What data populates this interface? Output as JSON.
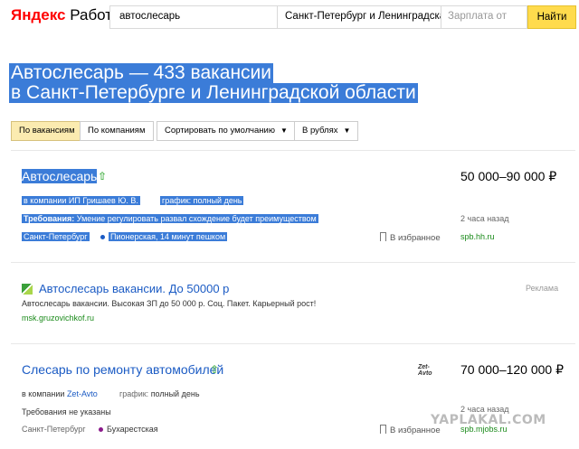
{
  "header": {
    "logo_brand": "Яндекс",
    "logo_product": "Работа",
    "query": "автослесарь",
    "region": "Санкт-Петербург и Ленинградская",
    "salary_placeholder": "Зарплата от",
    "find_label": "Найти"
  },
  "page": {
    "title_line1": "Автослесарь — 433 вакансии",
    "title_line2": "в Санкт-Петербурге и Ленинградской области"
  },
  "filters": {
    "by_vacancies": "По вакансиям",
    "by_companies": "По компаниям",
    "sort": "Сортировать по умолчанию",
    "currency": "В рублях"
  },
  "vacancies": [
    {
      "title": "Автослесарь",
      "company_prefix": "в компании ИП Гришаев Ю. В.",
      "schedule": "график: полный день",
      "requirements_label": "Требования:",
      "requirements": "Умение регулировать развал схождение будет преимуществом",
      "city": "Санкт-Петербург",
      "metro": "Пионерская, 14 минут пешком",
      "metro_color": "#1b5bc4",
      "salary": "50 000–90 000 ₽",
      "time": "2 часа назад",
      "bookmark": "В избранное",
      "source": "spb.hh.ru"
    },
    {
      "title": "Слесарь по ремонту автомобилей",
      "company_prefix": "в компании",
      "company_name": "Zet-Avto",
      "schedule_label": "график:",
      "schedule_value": "полный день",
      "requirements": "Требования не указаны",
      "city": "Санкт-Петербург",
      "metro": "Бухарестская",
      "metro_color": "#8b1a8b",
      "salary": "70 000–120 000 ₽",
      "time": "2 часа назад",
      "bookmark": "В избранное",
      "source": "spb.mjobs.ru",
      "company_logo": "Zet-Avto"
    }
  ],
  "ad": {
    "title": "Автослесарь вакансии. До 50000 р",
    "text": "Автослесарь вакансии. Высокая ЗП до 50 000 р. Соц. Пакет. Карьерный рост!",
    "url": "msk.gruzovichkof.ru",
    "label": "Реклама"
  },
  "watermark": "YAPLAKAL.COM"
}
